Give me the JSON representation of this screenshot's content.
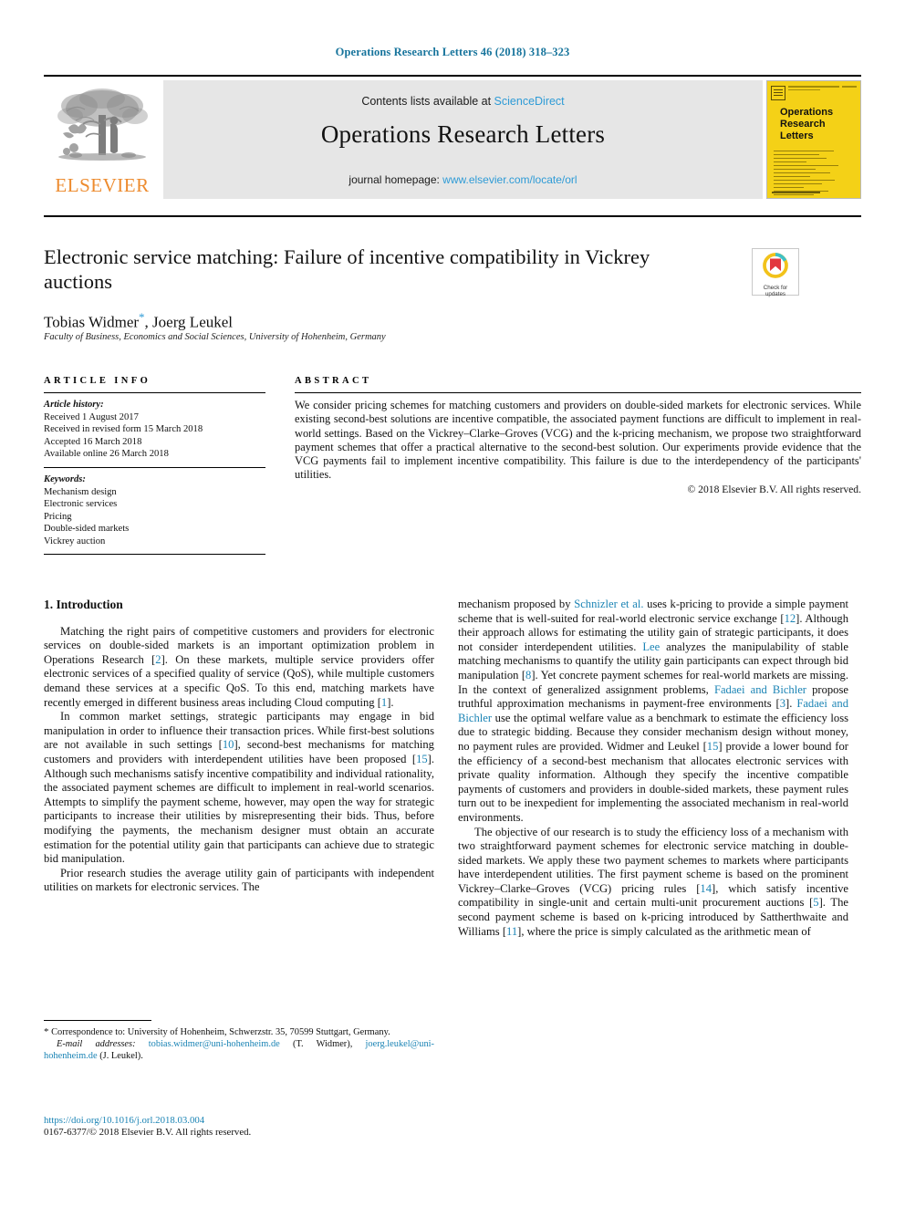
{
  "running_head": "Operations Research Letters 46 (2018) 318–323",
  "masthead": {
    "publisher_name": "ELSEVIER",
    "contents_prefix": "Contents lists available at ",
    "contents_link": "ScienceDirect",
    "journal_title": "Operations Research Letters",
    "homepage_prefix": "journal homepage: ",
    "homepage_link": "www.elsevier.com/locate/orl",
    "cover_title": "Operations\nResearch\nLetters"
  },
  "article": {
    "title": "Electronic service matching: Failure of incentive compatibility in Vickrey auctions",
    "authors": "Tobias Widmer",
    "authors_rest": ", Joerg Leukel",
    "affiliation": "Faculty of Business, Economics and Social Sciences, University of Hohenheim, Germany",
    "crossmark_label": "Check for\nupdates"
  },
  "article_info": {
    "heading": "ARTICLE INFO",
    "history_label": "Article history:",
    "history": [
      "Received 1 August 2017",
      "Received in revised form 15 March 2018",
      "Accepted 16 March 2018",
      "Available online 26 March 2018"
    ],
    "keywords_label": "Keywords:",
    "keywords": [
      "Mechanism design",
      "Electronic services",
      "Pricing",
      "Double-sided markets",
      "Vickrey auction"
    ]
  },
  "abstract": {
    "heading": "ABSTRACT",
    "text": "We consider pricing schemes for matching customers and providers on double-sided markets for electronic services. While existing second-best solutions are incentive compatible, the associated payment functions are difficult to implement in real-world settings. Based on the Vickrey–Clarke–Groves (VCG) and the k-pricing mechanism, we propose two straightforward payment schemes that offer a practical alternative to the second-best solution. Our experiments provide evidence that the VCG payments fail to implement incentive compatibility. This failure is due to the interdependency of the participants' utilities.",
    "copyright": "© 2018 Elsevier B.V. All rights reserved."
  },
  "body": {
    "section_number_title": "1. Introduction",
    "left_paragraphs": [
      "Matching the right pairs of competitive customers and providers for electronic services on double-sided markets is an important optimization problem in Operations Research [2]. On these markets, multiple service providers offer electronic services of a specified quality of service (QoS), while multiple customers demand these services at a specific QoS. To this end, matching markets have recently emerged in different business areas including Cloud computing [1].",
      "In common market settings, strategic participants may engage in bid manipulation in order to influence their transaction prices. While first-best solutions are not available in such settings [10], second-best mechanisms for matching customers and providers with interdependent utilities have been proposed [15]. Although such mechanisms satisfy incentive compatibility and individual rationality, the associated payment schemes are difficult to implement in real-world scenarios. Attempts to simplify the payment scheme, however, may open the way for strategic participants to increase their utilities by misrepresenting their bids. Thus, before modifying the payments, the mechanism designer must obtain an accurate estimation for the potential utility gain that participants can achieve due to strategic bid manipulation.",
      "Prior research studies the average utility gain of participants with independent utilities on markets for electronic services. The"
    ],
    "right_paragraphs": [
      "mechanism proposed by Schnizler et al. uses k-pricing to provide a simple payment scheme that is well-suited for real-world electronic service exchange [12]. Although their approach allows for estimating the utility gain of strategic participants, it does not consider interdependent utilities. Lee analyzes the manipulability of stable matching mechanisms to quantify the utility gain participants can expect through bid manipulation [8]. Yet concrete payment schemes for real-world markets are missing. In the context of generalized assignment problems, Fadaei and Bichler propose truthful approximation mechanisms in payment-free environments [3]. Fadaei and Bichler use the optimal welfare value as a benchmark to estimate the efficiency loss due to strategic bidding. Because they consider mechanism design without money, no payment rules are provided. Widmer and Leukel [15] provide a lower bound for the efficiency of a second-best mechanism that allocates electronic services with private quality information. Although they specify the incentive compatible payments of customers and providers in double-sided markets, these payment rules turn out to be inexpedient for implementing the associated mechanism in real-world environments.",
      "The objective of our research is to study the efficiency loss of a mechanism with two straightforward payment schemes for electronic service matching in double-sided markets. We apply these two payment schemes to markets where participants have interdependent utilities. The first payment scheme is based on the prominent Vickrey–Clarke–Groves (VCG) pricing rules [14], which satisfy incentive compatibility in single-unit and certain multi-unit procurement auctions [5]. The second payment scheme is based on k-pricing introduced by  Sattherthwaite and Williams [11], where the price is simply calculated as the arithmetic mean of"
    ]
  },
  "footnotes": {
    "correspondence": "Correspondence to: University of Hohenheim, Schwerzstr. 35, 70599 Stuttgart, Germany.",
    "email_label": "E-mail addresses:",
    "email1": "tobias.widmer@uni-hohenheim.de",
    "email1_owner": "(T. Widmer),",
    "email2": "joerg.leukel@uni-hohenheim.de",
    "email2_owner": "(J. Leukel).",
    "doi": "https://doi.org/10.1016/j.orl.2018.03.004",
    "issn_line": "0167-6377/© 2018 Elsevier B.V. All rights reserved."
  },
  "colors": {
    "link": "#1b84b5",
    "banner_link": "#2e9bd6",
    "running_head": "#17749c",
    "elsevier_orange": "#ed8b2e",
    "cover_yellow": "#f4d117"
  }
}
